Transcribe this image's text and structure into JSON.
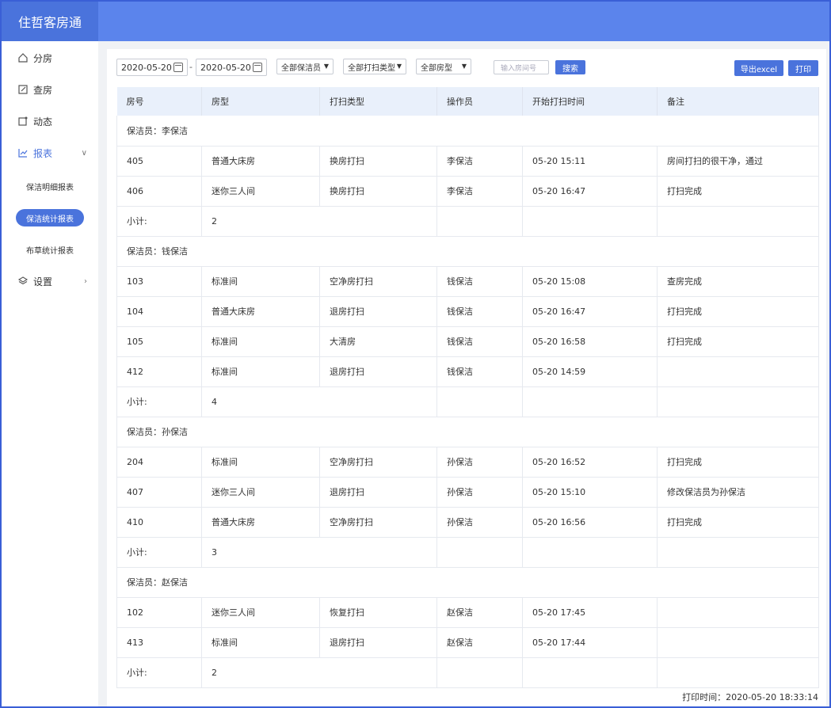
{
  "app": {
    "title": "住哲客房通"
  },
  "sidebar": {
    "items": [
      {
        "label": "分房",
        "icon": "home-icon"
      },
      {
        "label": "查房",
        "icon": "edit-icon"
      },
      {
        "label": "动态",
        "icon": "notice-icon"
      },
      {
        "label": "报表",
        "icon": "chart-icon"
      },
      {
        "label": "设置",
        "icon": "layers-icon"
      }
    ],
    "report_subitems": [
      "保洁明细报表",
      "保洁统计报表",
      "布草统计报表"
    ],
    "selected_subitem": "保洁统计报表"
  },
  "toolbar": {
    "date_from": "2020-05-20",
    "date_to": "2020-05-20",
    "date_sep": "-",
    "cleaner_select": "全部保洁员",
    "clean_type_select": "全部打扫类型",
    "room_type_select": "全部房型",
    "room_input_placeholder": "输入房间号",
    "search_label": "搜索",
    "export_label": "导出excel",
    "print_label": "打印"
  },
  "table": {
    "columns": [
      "房号",
      "房型",
      "打扫类型",
      "操作员",
      "开始打扫时间",
      "备注"
    ],
    "groups": [
      {
        "header": "保洁员：李保洁",
        "rows": [
          [
            "405",
            "普通大床房",
            "换房打扫",
            "李保洁",
            "05-20 15:11",
            "房间打扫的很干净，通过"
          ],
          [
            "406",
            "迷你三人间",
            "换房打扫",
            "李保洁",
            "05-20 16:47",
            "打扫完成"
          ]
        ],
        "subtotal_label": "小计:",
        "subtotal": "2"
      },
      {
        "header": "保洁员：钱保洁",
        "rows": [
          [
            "103",
            "标准间",
            "空净房打扫",
            "钱保洁",
            "05-20 15:08",
            "查房完成"
          ],
          [
            "104",
            "普通大床房",
            "退房打扫",
            "钱保洁",
            "05-20 16:47",
            "打扫完成"
          ],
          [
            "105",
            "标准间",
            "大清房",
            "钱保洁",
            "05-20 16:58",
            "打扫完成"
          ],
          [
            "412",
            "标准间",
            "退房打扫",
            "钱保洁",
            "05-20 14:59",
            ""
          ]
        ],
        "subtotal_label": "小计:",
        "subtotal": "4"
      },
      {
        "header": "保洁员：孙保洁",
        "rows": [
          [
            "204",
            "标准间",
            "空净房打扫",
            "孙保洁",
            "05-20 16:52",
            "打扫完成"
          ],
          [
            "407",
            "迷你三人间",
            "退房打扫",
            "孙保洁",
            "05-20 15:10",
            "修改保洁员为孙保洁"
          ],
          [
            "410",
            "普通大床房",
            "空净房打扫",
            "孙保洁",
            "05-20 16:56",
            "打扫完成"
          ]
        ],
        "subtotal_label": "小计:",
        "subtotal": "3"
      },
      {
        "header": "保洁员：赵保洁",
        "rows": [
          [
            "102",
            "迷你三人间",
            "恢复打扫",
            "赵保洁",
            "05-20 17:45",
            ""
          ],
          [
            "413",
            "标准间",
            "退房打扫",
            "赵保洁",
            "05-20 17:44",
            ""
          ]
        ],
        "subtotal_label": "小计:",
        "subtotal": "2"
      }
    ]
  },
  "footer": {
    "print_time": "打印时间：2020-05-20 18:33:14"
  },
  "colors": {
    "header": "#5b84ec",
    "brand": "#4a73dc",
    "accent": "#4a73dc"
  }
}
